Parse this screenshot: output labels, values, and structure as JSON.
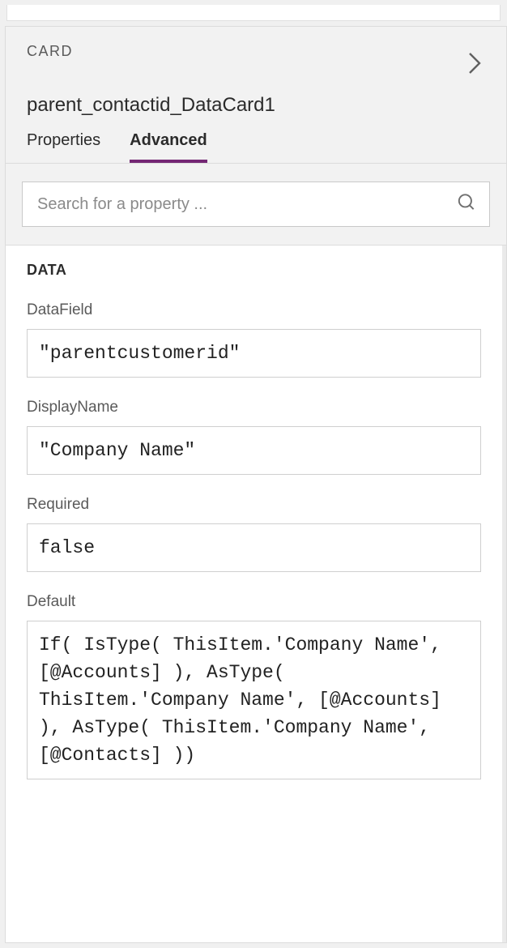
{
  "panel": {
    "type_label": "CARD",
    "control_name": "parent_contactid_DataCard1"
  },
  "tabs": {
    "properties": "Properties",
    "advanced": "Advanced"
  },
  "search": {
    "placeholder": "Search for a property ..."
  },
  "section": {
    "data_label": "DATA"
  },
  "props": {
    "datafield": {
      "label": "DataField",
      "value": "\"parentcustomerid\""
    },
    "displayname": {
      "label": "DisplayName",
      "value": "\"Company Name\""
    },
    "required": {
      "label": "Required",
      "value": "false"
    },
    "default": {
      "label": "Default",
      "value": "If( IsType( ThisItem.'Company Name', [@Accounts] ), AsType( ThisItem.'Company Name', [@Accounts] ), AsType( ThisItem.'Company Name', [@Contacts] ))"
    }
  }
}
